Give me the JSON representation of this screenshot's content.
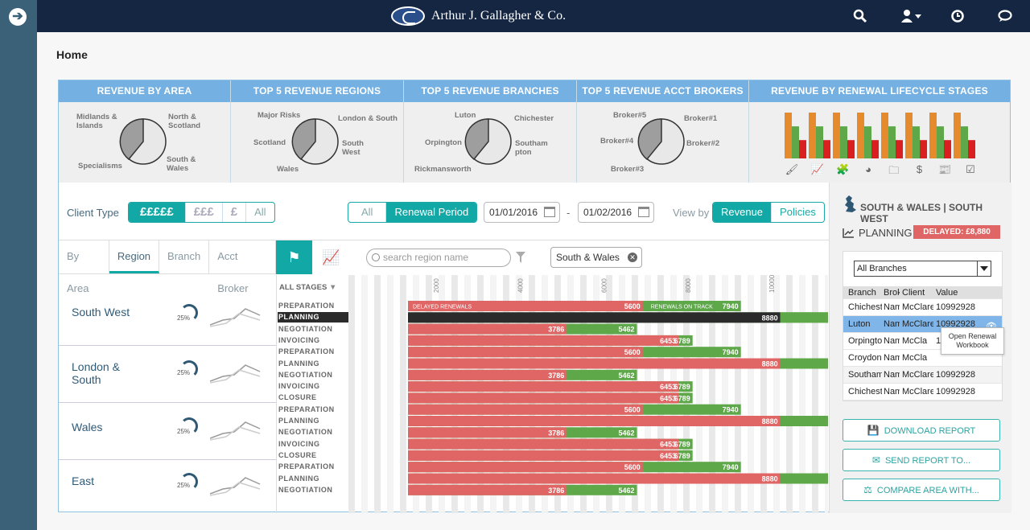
{
  "header": {
    "brand": "Arthur J. Gallagher & Co."
  },
  "page": {
    "title": "Home"
  },
  "kpis": {
    "revenue_by_area": {
      "title": "REVENUE BY AREA",
      "labels": [
        "Midlands & Islands",
        "North & Scotland",
        "South & Wales",
        "Specialisms"
      ]
    },
    "top5_regions": {
      "title": "TOP 5 REVENUE REGIONS",
      "labels": [
        "Major Risks",
        "London & South",
        "Scotland",
        "South West",
        "Wales"
      ]
    },
    "top5_branches": {
      "title": "TOP 5 REVENUE BRANCHES",
      "labels": [
        "Luton",
        "Chichester",
        "Orpington",
        "Southampton",
        "Rickmansworth"
      ]
    },
    "top5_brokers": {
      "title": "TOP 5 REVENUE ACCT BROKERS",
      "labels": [
        "Broker#5",
        "Broker#1",
        "Broker#4",
        "Broker#2",
        "Broker#3"
      ]
    },
    "lifecycle": {
      "title": "REVENUE BY RENEWAL LIFECYCLE STAGES",
      "icons": [
        "brush-icon",
        "line-chart-icon",
        "puzzle-icon",
        "pie-chart-icon",
        "folder-icon",
        "dollar-icon",
        "newspaper-icon",
        "checkbox-icon"
      ]
    }
  },
  "filters": {
    "client_type_label": "Client Type",
    "client_type_options": [
      "£££££",
      "£££",
      "£",
      "All"
    ],
    "period_options": [
      "All",
      "Renewal Period"
    ],
    "date_from": "01/01/2016",
    "date_sep": "-",
    "date_to": "01/02/2016",
    "view_by_label": "View by",
    "view_by_options": [
      "Revenue",
      "Policies"
    ]
  },
  "tabs": [
    "By Area",
    "Region",
    "Branch",
    "Acct Broker"
  ],
  "search": {
    "placeholder": "search region name",
    "chip": "South & Wales"
  },
  "stages_header": "ALL STAGES",
  "regions": [
    {
      "name": "South West",
      "pct": "25%"
    },
    {
      "name": "London & South",
      "pct": "25%"
    },
    {
      "name": "Wales",
      "pct": "25%"
    },
    {
      "name": "East",
      "pct": "25%"
    }
  ],
  "chart_data": {
    "type": "bar",
    "x_ticks": [
      "2000",
      "4000",
      "6000",
      "8000",
      "10000"
    ],
    "legend_labels": {
      "delayed": "DELAYED RENEWALS",
      "on_track": "RENEWALS ON TRACK"
    },
    "colors": {
      "delayed": "#e06565",
      "on_track": "#5ea84a",
      "highlight": "#2b2b2b"
    },
    "rows": [
      {
        "stage": "PREPARATION",
        "red": 5600,
        "green": 7940
      },
      {
        "stage": "PLANNING",
        "red": 8880,
        "green": 10890,
        "highlight": true
      },
      {
        "stage": "NEGOTIATION",
        "red": 3786,
        "green": 5462
      },
      {
        "stage": "INVOICING",
        "red": 6453,
        "green": 6789
      },
      {
        "stage": "PREPARATION",
        "red": 5600,
        "green": 7940
      },
      {
        "stage": "PLANNING",
        "red": 8880,
        "green": 10890
      },
      {
        "stage": "NEGOTIATION",
        "red": 3786,
        "green": 5462
      },
      {
        "stage": "INVOICING",
        "red": 6453,
        "green": 6789
      },
      {
        "stage": "CLOSURE",
        "red": 6453,
        "green": 6789
      },
      {
        "stage": "PREPARATION",
        "red": 5600,
        "green": 7940
      },
      {
        "stage": "PLANNING",
        "red": 8880,
        "green": 10890
      },
      {
        "stage": "NEGOTIATION",
        "red": 3786,
        "green": 5462
      },
      {
        "stage": "INVOICING",
        "red": 6453,
        "green": 6789
      },
      {
        "stage": "CLOSURE",
        "red": 6453,
        "green": 6789
      },
      {
        "stage": "PREPARATION",
        "red": 5600,
        "green": 7940
      },
      {
        "stage": "PLANNING",
        "red": 8880,
        "green": 10890
      },
      {
        "stage": "NEGOTIATION",
        "red": 3786,
        "green": 5462
      }
    ]
  },
  "lifecycle_chart": {
    "type": "bar",
    "colors": [
      "#e68a2e",
      "#5ea84a",
      "#d91f1f"
    ],
    "groups": [
      [
        10,
        7,
        4
      ],
      [
        10,
        7,
        4
      ],
      [
        10,
        7,
        4
      ],
      [
        10,
        7,
        4
      ],
      [
        10,
        7,
        4
      ],
      [
        10,
        7,
        4
      ],
      [
        10,
        7,
        4
      ],
      [
        10,
        7,
        4
      ]
    ]
  },
  "sidebar": {
    "title": "SOUTH & WALES | SOUTH WEST",
    "status": "PLANNING",
    "delayed": "DELAYED:  £8,880",
    "branch_select": "All Branches",
    "table_headers": [
      "Branch",
      "Brok",
      "Client",
      "Value"
    ],
    "rows": [
      [
        "Chichest",
        "Nam",
        "McClare",
        "10992928"
      ],
      [
        "Luton",
        "Nam",
        "McClare",
        "10992928"
      ],
      [
        "Orpingto",
        "Nam",
        "McCla",
        "10992928"
      ],
      [
        "Croydon",
        "Nam",
        "McCla",
        ""
      ],
      [
        "Southam",
        "Nam",
        "McClare",
        "10992928"
      ],
      [
        "Chichest",
        "Nam",
        "McClare",
        "10992928"
      ]
    ],
    "tooltip": "Open Renewal Workbook",
    "buttons": [
      "DOWNLOAD REPORT",
      "SEND REPORT TO...",
      "COMPARE AREA WITH..."
    ]
  }
}
